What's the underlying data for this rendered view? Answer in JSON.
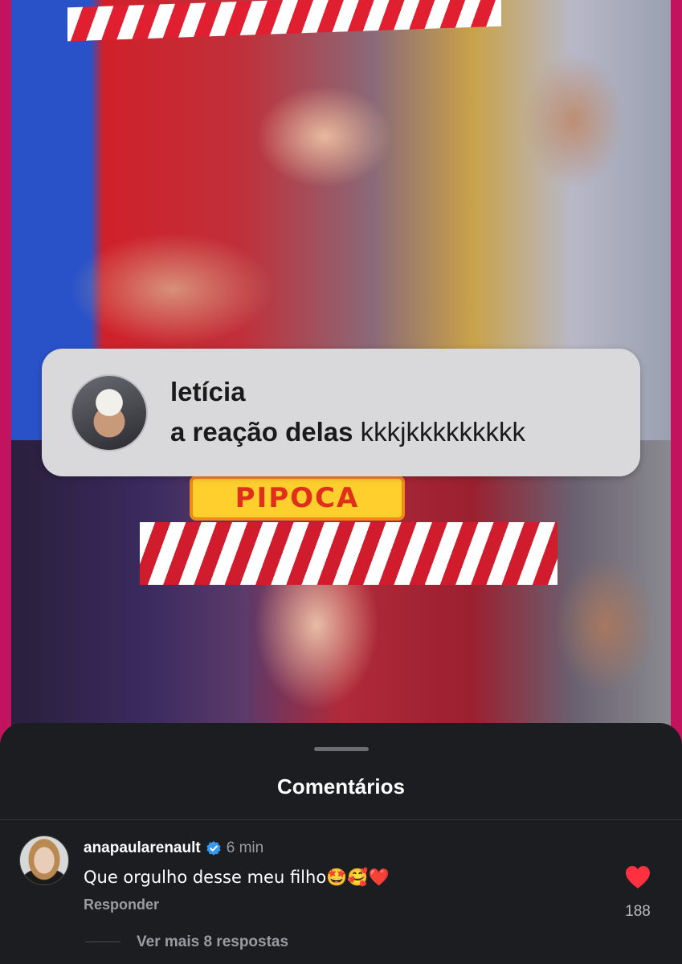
{
  "story_reply": {
    "username": "letícia",
    "message_bold": "a reação delas",
    "message_rest": " kkkjkkkkkkkkk"
  },
  "video": {
    "sign_text": "PIPOCA"
  },
  "comments_sheet": {
    "title": "Comentários",
    "comment": {
      "username": "anapaularenault",
      "verified_icon": "verified-badge-icon",
      "time": "6 min",
      "text": "Que orgulho desse meu filho🤩🥰❤️",
      "reply_label": "Responder",
      "like_icon": "heart-icon",
      "like_count": "188",
      "view_more_replies": "Ver mais 8 respostas"
    }
  },
  "colors": {
    "page_border": "#c2135f",
    "sheet_bg": "#1b1d21",
    "verified_blue": "#3897f0",
    "heart_red": "#ff3040"
  }
}
